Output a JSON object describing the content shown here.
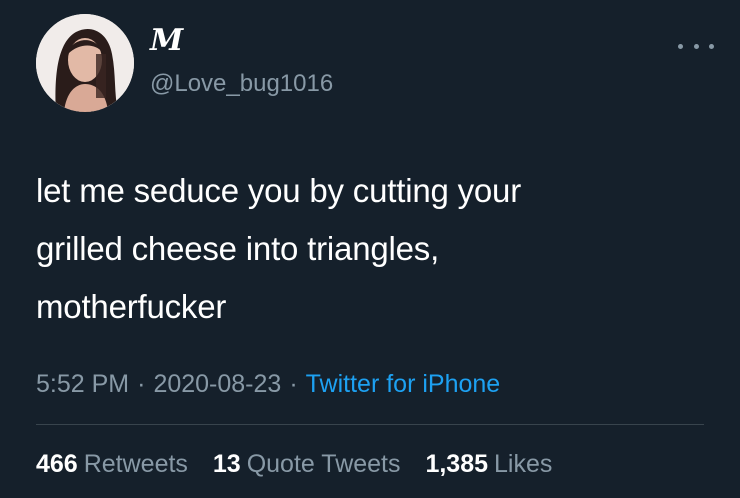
{
  "user": {
    "display_name": "M",
    "handle": "@Love_bug1016",
    "avatar_icon": "profile-photo"
  },
  "tweet": {
    "lines": [
      "let me seduce you by cutting your",
      "grilled cheese into triangles,",
      "motherfucker"
    ]
  },
  "meta": {
    "time": "5:52 PM",
    "separator": "·",
    "date": "2020-08-23",
    "source": "Twitter for iPhone"
  },
  "stats": {
    "retweets_count": "466",
    "retweets_label": "Retweets",
    "quotes_count": "13",
    "quotes_label": "Quote Tweets",
    "likes_count": "1,385",
    "likes_label": "Likes"
  },
  "colors": {
    "background": "#15202b",
    "text": "#ffffff",
    "secondary": "#8899a6",
    "link": "#1da1f2",
    "divider": "#38444d"
  }
}
